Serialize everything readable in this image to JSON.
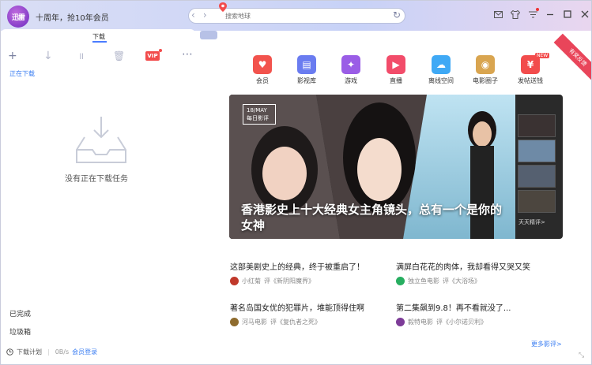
{
  "titlebar": {
    "logo_text": "迅雷",
    "promo": "十周年，抢10年会员",
    "search_placeholder": "搜索地球",
    "window_icons": [
      "mail-icon",
      "shirt-icon",
      "menu-icon",
      "minimize-icon",
      "maximize-icon",
      "close-icon"
    ]
  },
  "tabs": {
    "active_label": "下载"
  },
  "toolbar": {
    "vip_label": "VIP"
  },
  "left": {
    "downloading_label": "正在下载",
    "empty_text": "没有正在下载任务",
    "completed_label": "已完成",
    "trash_label": "垃圾箱"
  },
  "status": {
    "plan_label": "下载计划",
    "speed": "0B/s",
    "login_label": "会员登录"
  },
  "apps": [
    {
      "label": "会员",
      "color": "#f2534d",
      "glyph": "♥"
    },
    {
      "label": "影视库",
      "color": "#6a7cf0",
      "glyph": "▤"
    },
    {
      "label": "游戏",
      "color": "#9a5de6",
      "glyph": "✦"
    },
    {
      "label": "直播",
      "color": "#f24c6a",
      "glyph": "▶"
    },
    {
      "label": "离线空间",
      "color": "#3fa9f5",
      "glyph": "☁"
    },
    {
      "label": "电影圈子",
      "color": "#d9a550",
      "glyph": "◉"
    },
    {
      "label": "发帖送钱",
      "color": "#f24c4c",
      "glyph": "¥"
    }
  ],
  "apps_new_tag": "NEW",
  "corner_ribbon": "有奖反馈",
  "banner": {
    "date": "18/MAY",
    "date_sub": "每日影评",
    "title": "香港影史上十大经典女主角镜头，总有一个是你的女神",
    "more_thumbs": "天天精评>"
  },
  "articles": [
    {
      "title": "这部美剧史上的经典，终于被重启了！",
      "author": "小红菊",
      "ref": "评《新阴阳魔界》",
      "avatar_color": "#c0392b"
    },
    {
      "title": "满屏白花花的肉体，我却看得又哭又笑",
      "author": "独立鱼电影",
      "ref": "评《大浴场》",
      "avatar_color": "#27ae60"
    },
    {
      "title": "著名岛国女优的犯罪片，堆能顶得住啊",
      "author": "河马电影",
      "ref": "评《复仇者之死》",
      "avatar_color": "#8e6b2e"
    },
    {
      "title": "第二集飙到9.8！再不看就没了...",
      "author": "毅特电影",
      "ref": "评《小尔诺贝利》",
      "avatar_color": "#7d3c98"
    }
  ],
  "more_link": "更多影评>"
}
